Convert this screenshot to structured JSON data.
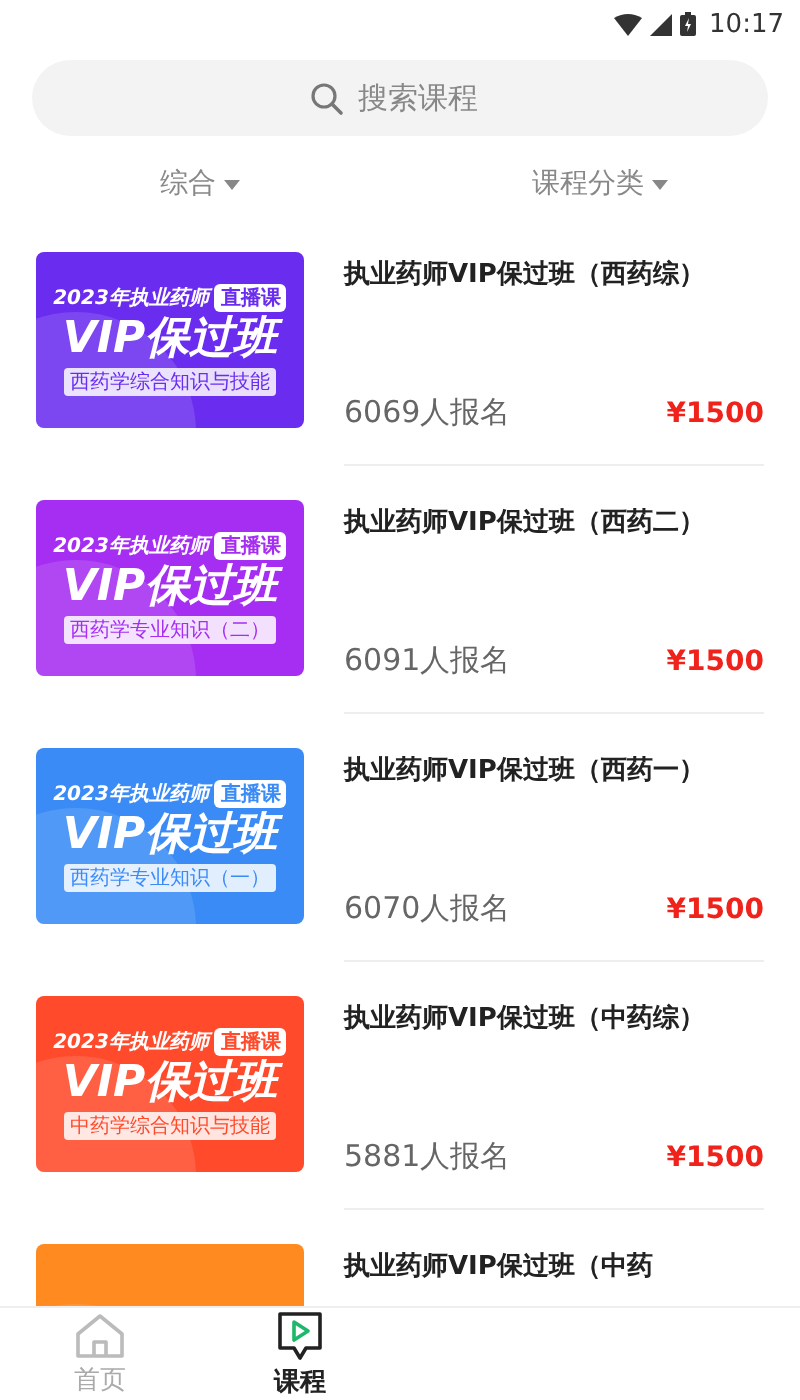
{
  "status_bar": {
    "time": "10:17"
  },
  "search": {
    "placeholder": "搜索课程"
  },
  "filters": [
    {
      "label": "综合"
    },
    {
      "label": "课程分类"
    }
  ],
  "courses": [
    {
      "title": "执业药师VIP保过班（西药综）",
      "enrolled": "6069人报名",
      "price": "¥1500",
      "banner": {
        "year_line": "2023年执业药师",
        "badge": "直播课",
        "headline": "VIP保过班",
        "subtitle": "西药学综合知识与技能",
        "color": "#6a2df0"
      }
    },
    {
      "title": "执业药师VIP保过班（西药二）",
      "enrolled": "6091人报名",
      "price": "¥1500",
      "banner": {
        "year_line": "2023年执业药师",
        "badge": "直播课",
        "headline": "VIP保过班",
        "subtitle": "西药学专业知识（二）",
        "color": "#a52ef2"
      }
    },
    {
      "title": "执业药师VIP保过班（西药一）",
      "enrolled": "6070人报名",
      "price": "¥1500",
      "banner": {
        "year_line": "2023年执业药师",
        "badge": "直播课",
        "headline": "VIP保过班",
        "subtitle": "西药学专业知识（一）",
        "color": "#3a8bf6"
      }
    },
    {
      "title": "执业药师VIP保过班（中药综）",
      "enrolled": "5881人报名",
      "price": "¥1500",
      "banner": {
        "year_line": "2023年执业药师",
        "badge": "直播课",
        "headline": "VIP保过班",
        "subtitle": "中药学综合知识与技能",
        "color": "#ff4a2b"
      }
    },
    {
      "title": "执业药师VIP保过班（中药",
      "banner": {
        "color": "#ff8a20"
      }
    }
  ],
  "nav": [
    {
      "label": "首页",
      "kind": "home",
      "selected": false
    },
    {
      "label": "课程",
      "kind": "play",
      "selected": true
    }
  ]
}
